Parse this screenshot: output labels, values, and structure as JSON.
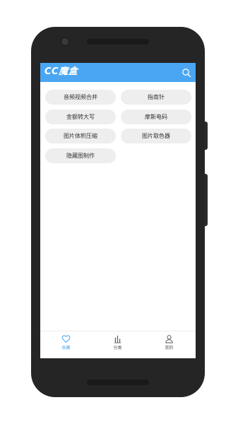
{
  "app": {
    "title": "CC魔盒"
  },
  "tools": [
    {
      "label": "音频视频合并"
    },
    {
      "label": "指南针"
    },
    {
      "label": "金额转大写"
    },
    {
      "label": "摩斯电码"
    },
    {
      "label": "图片体积压缩"
    },
    {
      "label": "图片取色器"
    },
    {
      "label": "隐藏图制作"
    }
  ],
  "tabs": [
    {
      "label": "收藏",
      "icon": "heart-icon",
      "active": true
    },
    {
      "label": "分类",
      "icon": "bar-chart-icon",
      "active": false
    },
    {
      "label": "我的",
      "icon": "user-icon",
      "active": false
    }
  ],
  "colors": {
    "accent": "#4aa6f2",
    "chip_bg": "#eeeeee",
    "phone_body": "#252525"
  }
}
